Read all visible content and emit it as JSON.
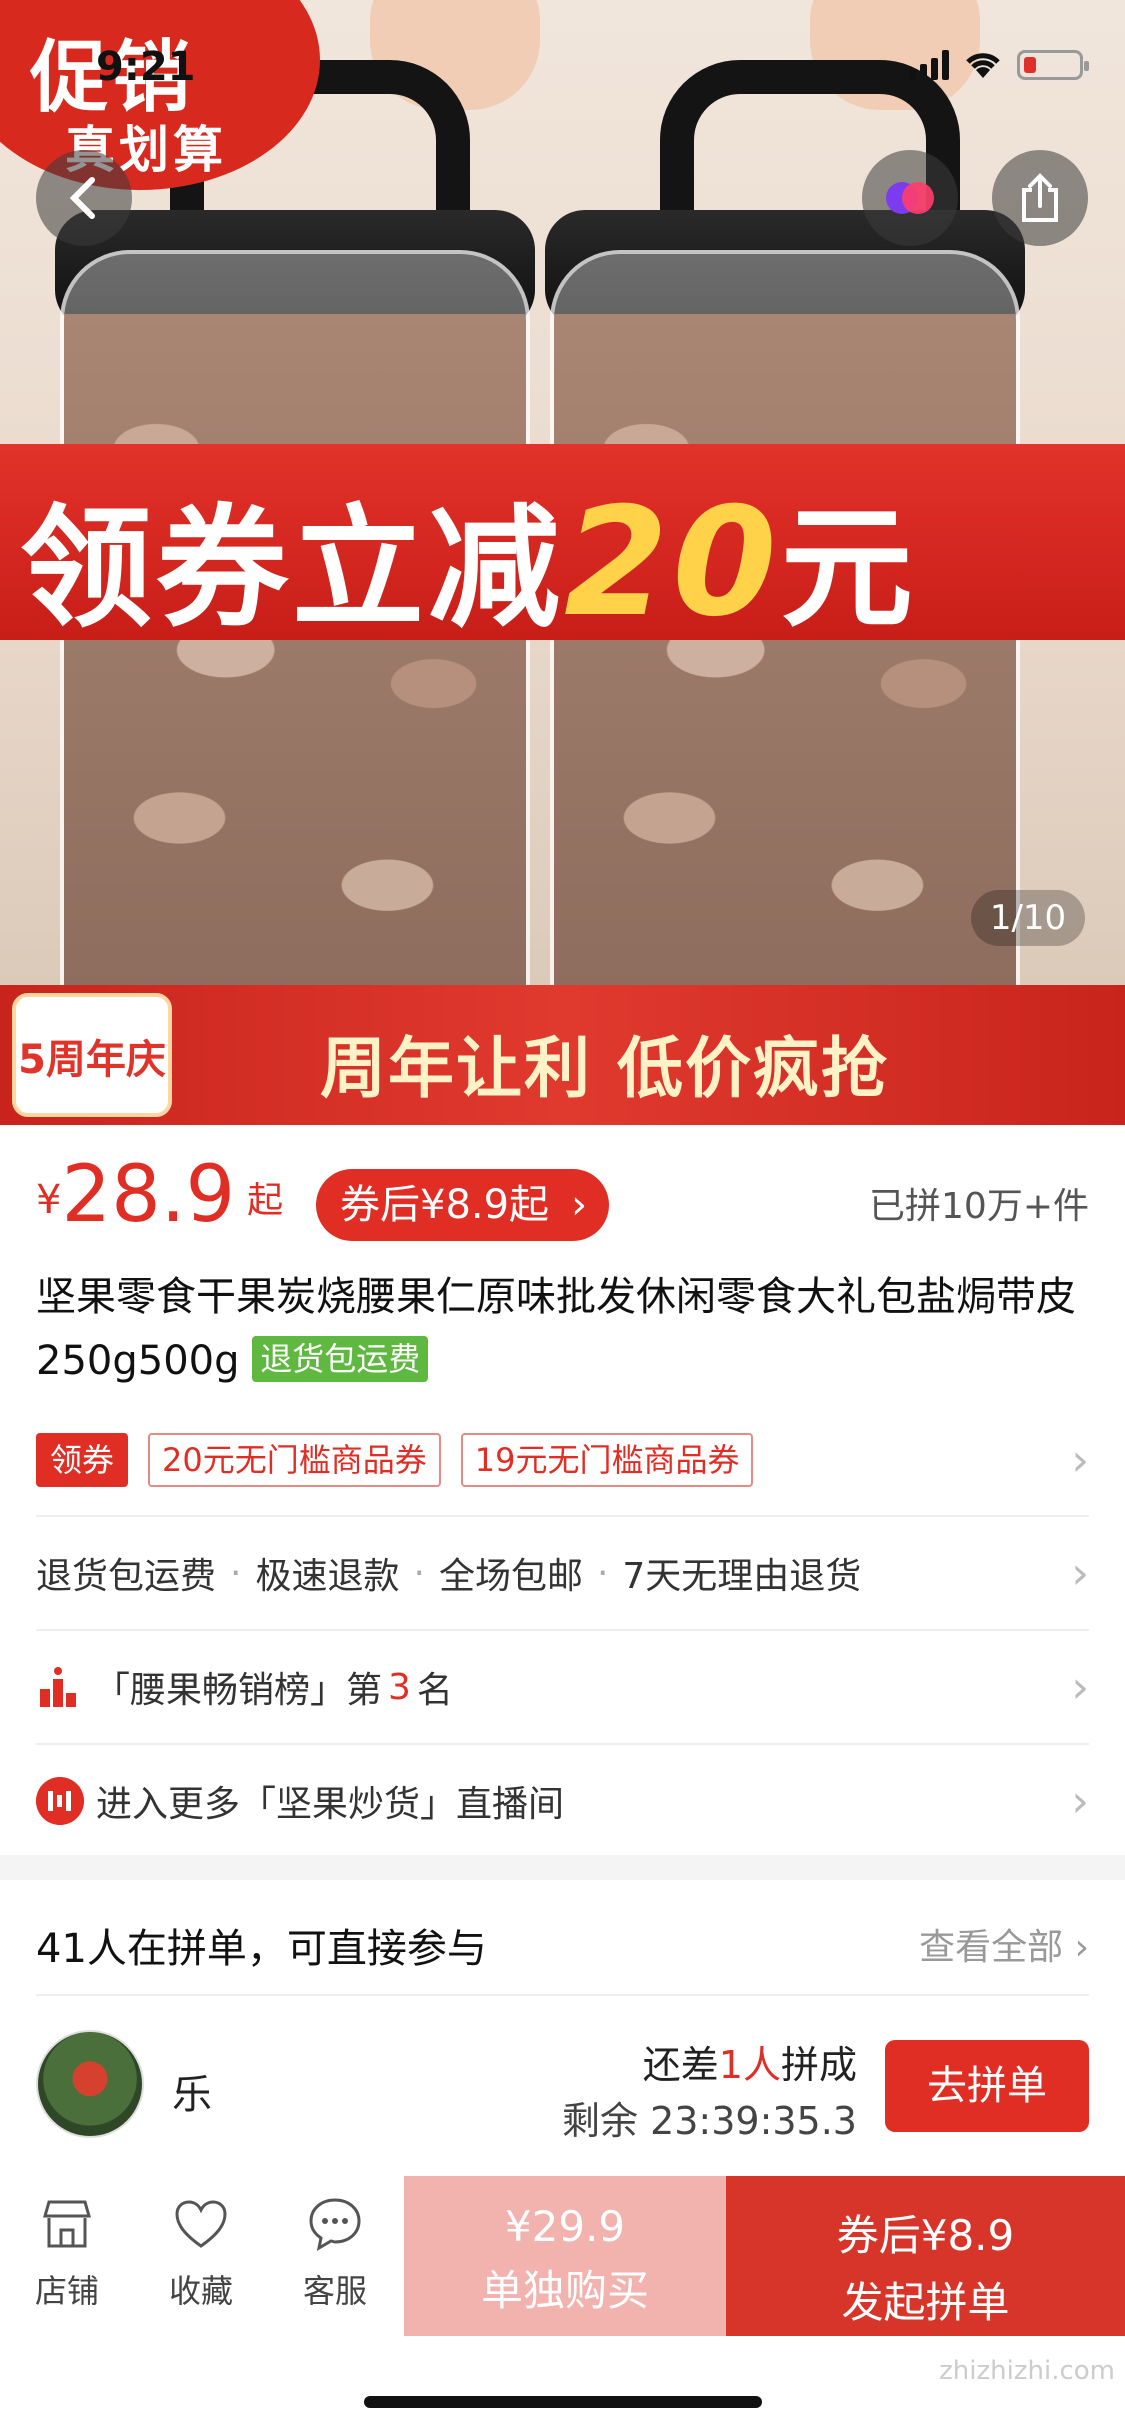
{
  "status_bar": {
    "time": "9:21"
  },
  "hero": {
    "promo_badge_line1": "促销",
    "promo_badge_line2": "真划算",
    "coupon_banner_prefix": "领券立减",
    "coupon_banner_amount": "20",
    "coupon_banner_suffix": "元",
    "anniversary_logo": "5周年庆",
    "anniversary_slogan": "周年让利 低价疯抢",
    "image_counter": "1/10"
  },
  "product": {
    "currency": "¥",
    "price": "28.9",
    "price_suffix": "起",
    "after_coupon_pill": "券后¥8.9起",
    "sold": "已拼10万+件",
    "title": "坚果零食干果炭烧腰果仁原味批发休闲零食大礼包盐焗带皮250g500g",
    "title_tag": "退货包运费",
    "coupon_label": "领券",
    "coupons": [
      "20元无门槛商品券",
      "19元无门槛商品券"
    ],
    "services": [
      "退货包运费",
      "极速退款",
      "全场包邮",
      "7天无理由退货"
    ],
    "rank_prefix": "「腰果畅销榜」第",
    "rank_number": "3",
    "rank_suffix": "名",
    "live_text": "进入更多「坚果炒货」直播间"
  },
  "group_buy": {
    "header": "41人在拼单，可直接参与",
    "see_all": "查看全部",
    "user_name": "乐",
    "need_prefix": "还差",
    "need_count": "1人",
    "need_suffix": "拼成",
    "remaining": "剩余 23:39:35.3",
    "join_button": "去拼单"
  },
  "bottom_bar": {
    "tabs": [
      {
        "label": "店铺",
        "icon": "store-icon"
      },
      {
        "label": "收藏",
        "icon": "heart-icon"
      },
      {
        "label": "客服",
        "icon": "chat-icon"
      }
    ],
    "solo_price": "¥29.9",
    "solo_label": "单独购买",
    "group_price": "券后¥8.9",
    "group_label": "发起拼单"
  },
  "watermark": "zhizhizhi.com",
  "colors": {
    "accent": "#e02e24",
    "solo_button": "#f2b2ae",
    "green_tag": "#5fb840"
  }
}
